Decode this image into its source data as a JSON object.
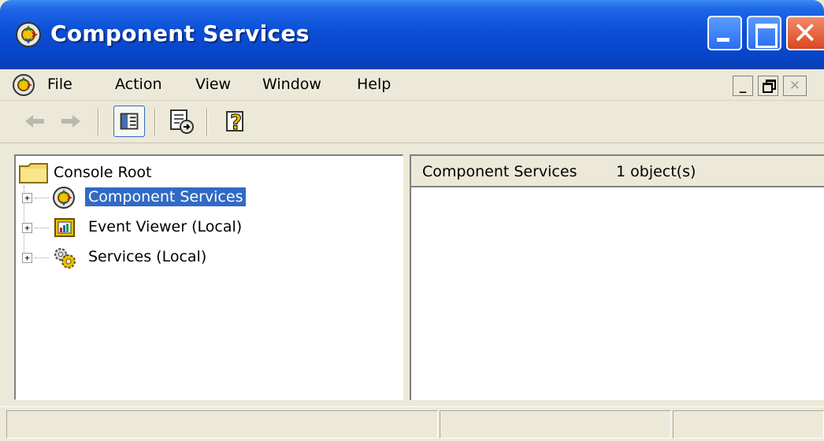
{
  "window": {
    "title": "Component Services",
    "icon": "component-services-icon"
  },
  "title_buttons": {
    "close_glyph": "✕"
  },
  "menu": {
    "items": [
      "File",
      "Action",
      "View",
      "Window",
      "Help"
    ]
  },
  "mdi_controls": {
    "minimize": "_",
    "close": "✕"
  },
  "toolbar": {
    "buttons": [
      "back-arrow-icon",
      "forward-arrow-icon",
      "show-hide-console-tree-icon",
      "export-list-icon",
      "help-icon"
    ]
  },
  "tree": {
    "root": "Console Root",
    "nodes": [
      {
        "label": "Component Services",
        "icon": "component-services-icon",
        "expander": "+",
        "selected": true
      },
      {
        "label": "Event Viewer (Local)",
        "icon": "event-viewer-icon",
        "expander": "+",
        "selected": false
      },
      {
        "label": "Services (Local)",
        "icon": "services-gears-icon",
        "expander": "+",
        "selected": false
      }
    ]
  },
  "details": {
    "title": "Component Services",
    "count": "1 object(s)"
  },
  "colors": {
    "titlebar": "#0a4fd6",
    "selection": "#316ac5",
    "chrome": "#ece9d8"
  }
}
